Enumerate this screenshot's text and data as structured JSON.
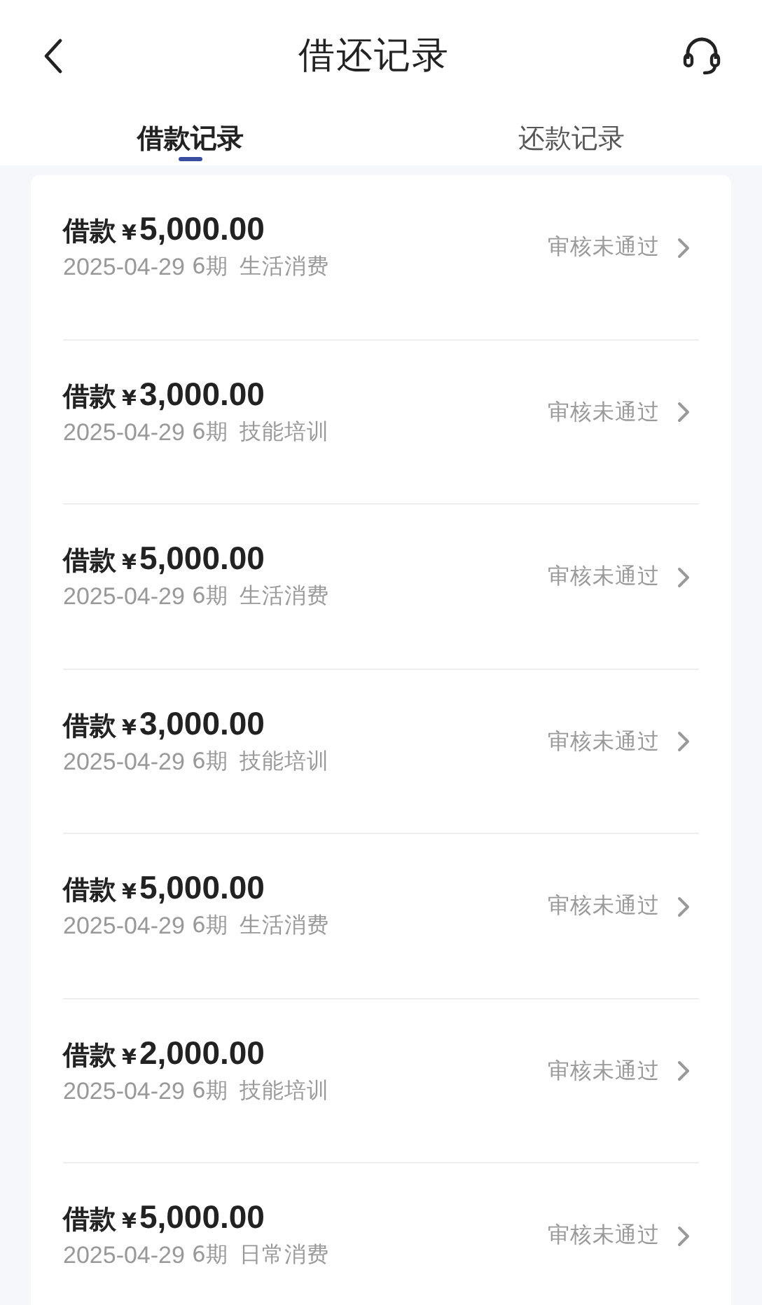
{
  "header": {
    "title": "借还记录"
  },
  "tabs": [
    {
      "label": "借款记录",
      "selected": true
    },
    {
      "label": "还款记录",
      "selected": false
    }
  ],
  "records": [
    {
      "label": "借款",
      "currency": "¥",
      "amount": "5,000.00",
      "date": "2025-04-29",
      "term": "6期",
      "purpose": "生活消费",
      "status": "审核未通过"
    },
    {
      "label": "借款",
      "currency": "¥",
      "amount": "3,000.00",
      "date": "2025-04-29",
      "term": "6期",
      "purpose": "技能培训",
      "status": "审核未通过"
    },
    {
      "label": "借款",
      "currency": "¥",
      "amount": "5,000.00",
      "date": "2025-04-29",
      "term": "6期",
      "purpose": "生活消费",
      "status": "审核未通过"
    },
    {
      "label": "借款",
      "currency": "¥",
      "amount": "3,000.00",
      "date": "2025-04-29",
      "term": "6期",
      "purpose": "技能培训",
      "status": "审核未通过"
    },
    {
      "label": "借款",
      "currency": "¥",
      "amount": "5,000.00",
      "date": "2025-04-29",
      "term": "6期",
      "purpose": "生活消费",
      "status": "审核未通过"
    },
    {
      "label": "借款",
      "currency": "¥",
      "amount": "2,000.00",
      "date": "2025-04-29",
      "term": "6期",
      "purpose": "技能培训",
      "status": "审核未通过"
    },
    {
      "label": "借款",
      "currency": "¥",
      "amount": "5,000.00",
      "date": "2025-04-29",
      "term": "6期",
      "purpose": "日常消费",
      "status": "审核未通过"
    }
  ]
}
